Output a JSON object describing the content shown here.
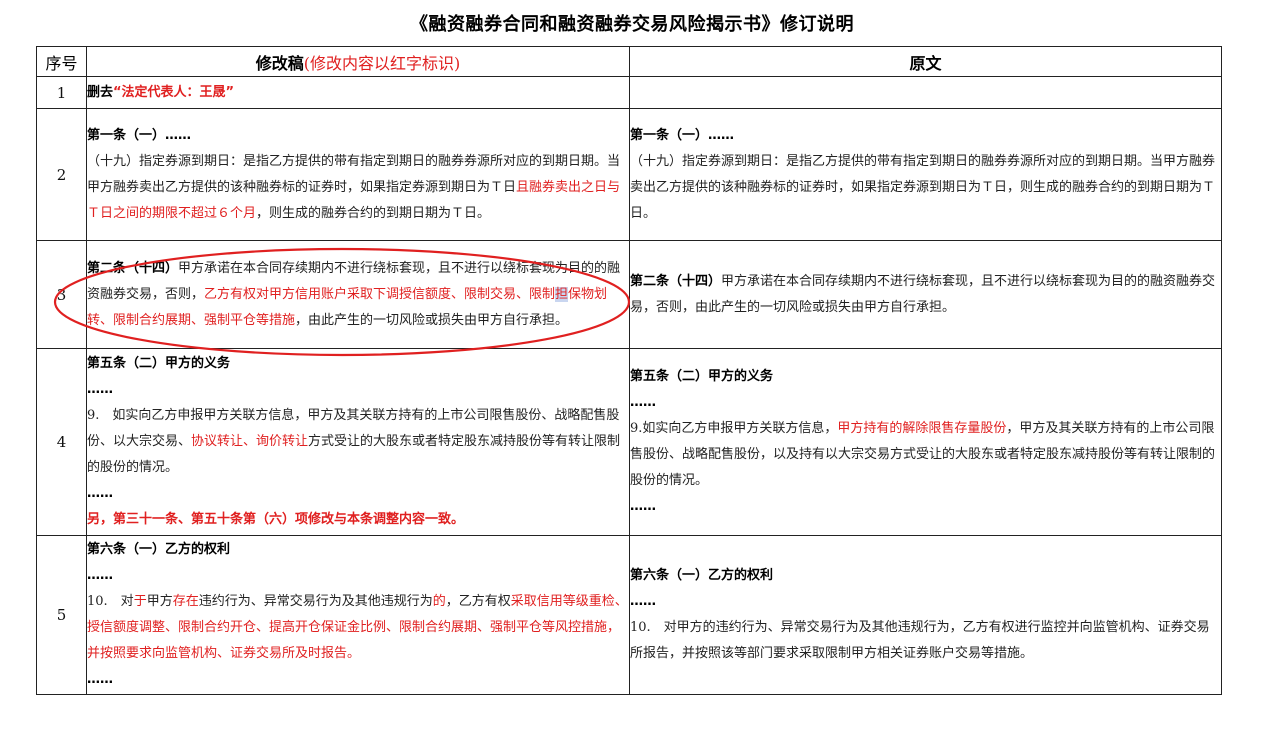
{
  "title": "《融资融券合同和融资融券交易风险揭示书》修订说明",
  "header": {
    "num": "序号",
    "revised": "修改稿",
    "revised_note": "(修改内容以红字标识)",
    "original": "原文"
  },
  "rows": [
    {
      "num": "1",
      "rev": {
        "prefix": "删去",
        "red": "“法定代表人：王晟”"
      }
    },
    {
      "num": "2",
      "rev": {
        "heading": "第一条（一）……",
        "t1": "（十九）指定券源到期日：是指乙方提供的带有指定到期日的融券券源所对应的到期日期。当甲方融券卖出乙方提供的该种融券标的证券时，如果指定券源到期日为Ｔ日",
        "red1": "且融券卖出之日与Ｔ日之间的期限不超过６个月",
        "t2": "，则生成的融券合约的到期日期为Ｔ日。"
      },
      "orig": {
        "heading": "第一条（一）……",
        "text": "（十九）指定券源到期日：是指乙方提供的带有指定到期日的融券券源所对应的到期日期。当甲方融券卖出乙方提供的该种融券标的证券时，如果指定券源到期日为Ｔ日，则生成的融券合约的到期日期为Ｔ日。"
      }
    },
    {
      "num": "3",
      "rev": {
        "heading": "第二条（十四）",
        "t1": "甲方承诺在本合同存续期内不进行绕标套现，且不进行以绕标套现为目的的融资融券交易，否则，",
        "red1": "乙方有权对甲方信用账户采取下调授信额度、限制交易、限制",
        "red_hl": "担",
        "red2": "保物划转、限制合约展期、强制平仓等措施",
        "t2": "，由此产生的一切风险或损失由甲方自行承担。"
      },
      "orig": {
        "heading": "第二条（十四）",
        "text": "甲方承诺在本合同存续期内不进行绕标套现，且不进行以绕标套现为目的的融资融券交易，否则，由此产生的一切风险或损失由甲方自行承担。"
      }
    },
    {
      "num": "4",
      "rev": {
        "heading": "第五条（二）甲方的义务",
        "dots1": "……",
        "t1": "9.　如实向乙方申报甲方关联方信息，甲方及其关联方持有的上市公司限售股份、战略配售股份、以大宗交易、",
        "red1": "协议转让、询价转让",
        "t2": "方式受让的大股东或者特定股东减持股份等有转让限制的股份的情况。",
        "dots2": "……",
        "note": "另，第三十一条、第五十条第（六）项修改与本条调整内容一致。"
      },
      "orig": {
        "heading": "第五条（二）甲方的义务",
        "dots1": "……",
        "t1": "9.如实向乙方申报甲方关联方信息，",
        "red1": "甲方持有的解除限售存量股份",
        "t2": "，甲方及其关联方持有的上市公司限售股份、战略配售股份，以及持有以大宗交易方式受让的大股东或者特定股东减持股份等有转让限制的股份的情况。",
        "dots2": "……"
      }
    },
    {
      "num": "5",
      "rev": {
        "heading": "第六条（一）乙方的权利",
        "dots1": "……",
        "t1": "10.　对",
        "red1": "于",
        "t2": "甲方",
        "red2": "存在",
        "t3": "违约行为、异常交易行为及其他违规行为",
        "red3": "的",
        "t4": "，乙方有权",
        "red4": "采取信用等级重检、授信额度调整、限制合约开仓、提高开仓保证金比例、限制合约展期、强制平仓等风控措施，并按照要求向监管机构、证券交易所及时报告。",
        "dots2": "……"
      },
      "orig": {
        "heading": "第六条（一）乙方的权利",
        "dots1": "……",
        "text": "10.　对甲方的违约行为、异常交易行为及其他违规行为，乙方有权进行监控并向监管机构、证券交易所报告，并按照该等部门要求采取限制甲方相关证券账户交易等措施。"
      }
    }
  ],
  "annotation": {
    "shape": "ellipse",
    "color": "#e02020"
  }
}
